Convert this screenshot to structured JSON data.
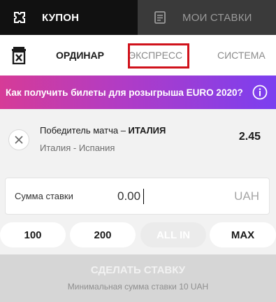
{
  "top_tabs": {
    "coupon": {
      "label": "КУПОН",
      "icon": "ticket-icon",
      "active": true
    },
    "my_bets": {
      "label": "МОИ СТАВКИ",
      "icon": "list-icon",
      "active": false
    }
  },
  "bet_types": {
    "trash_icon": "delete-all-icon",
    "items": [
      {
        "label": "ОРДИНАР",
        "active": true
      },
      {
        "label": "ЭКСПРЕСС",
        "active": false,
        "highlighted": true
      },
      {
        "label": "СИСТЕМА",
        "active": false
      }
    ]
  },
  "banner": {
    "text": "Как получить билеты для розыгрыша EURO 2020?",
    "icon": "info-icon"
  },
  "bet": {
    "market_prefix": "Победитель матча – ",
    "selection": "ИТАЛИЯ",
    "match": "Италия - Испания",
    "odds": "2.45",
    "remove_icon": "close-icon"
  },
  "stake": {
    "label": "Сумма ставки",
    "placeholder": "0.00",
    "currency": "UAH"
  },
  "quick_amounts": [
    "100",
    "200",
    "ALL IN",
    "MAX"
  ],
  "place_bet": {
    "label": "СДЕЛАТЬ СТАВКУ",
    "hint": "Минимальная сумма ставки 10 UAH"
  },
  "colors": {
    "highlight": "#d0121b",
    "banner_start": "#d63b97",
    "banner_end": "#7b3ff0",
    "dark": "#111111"
  }
}
